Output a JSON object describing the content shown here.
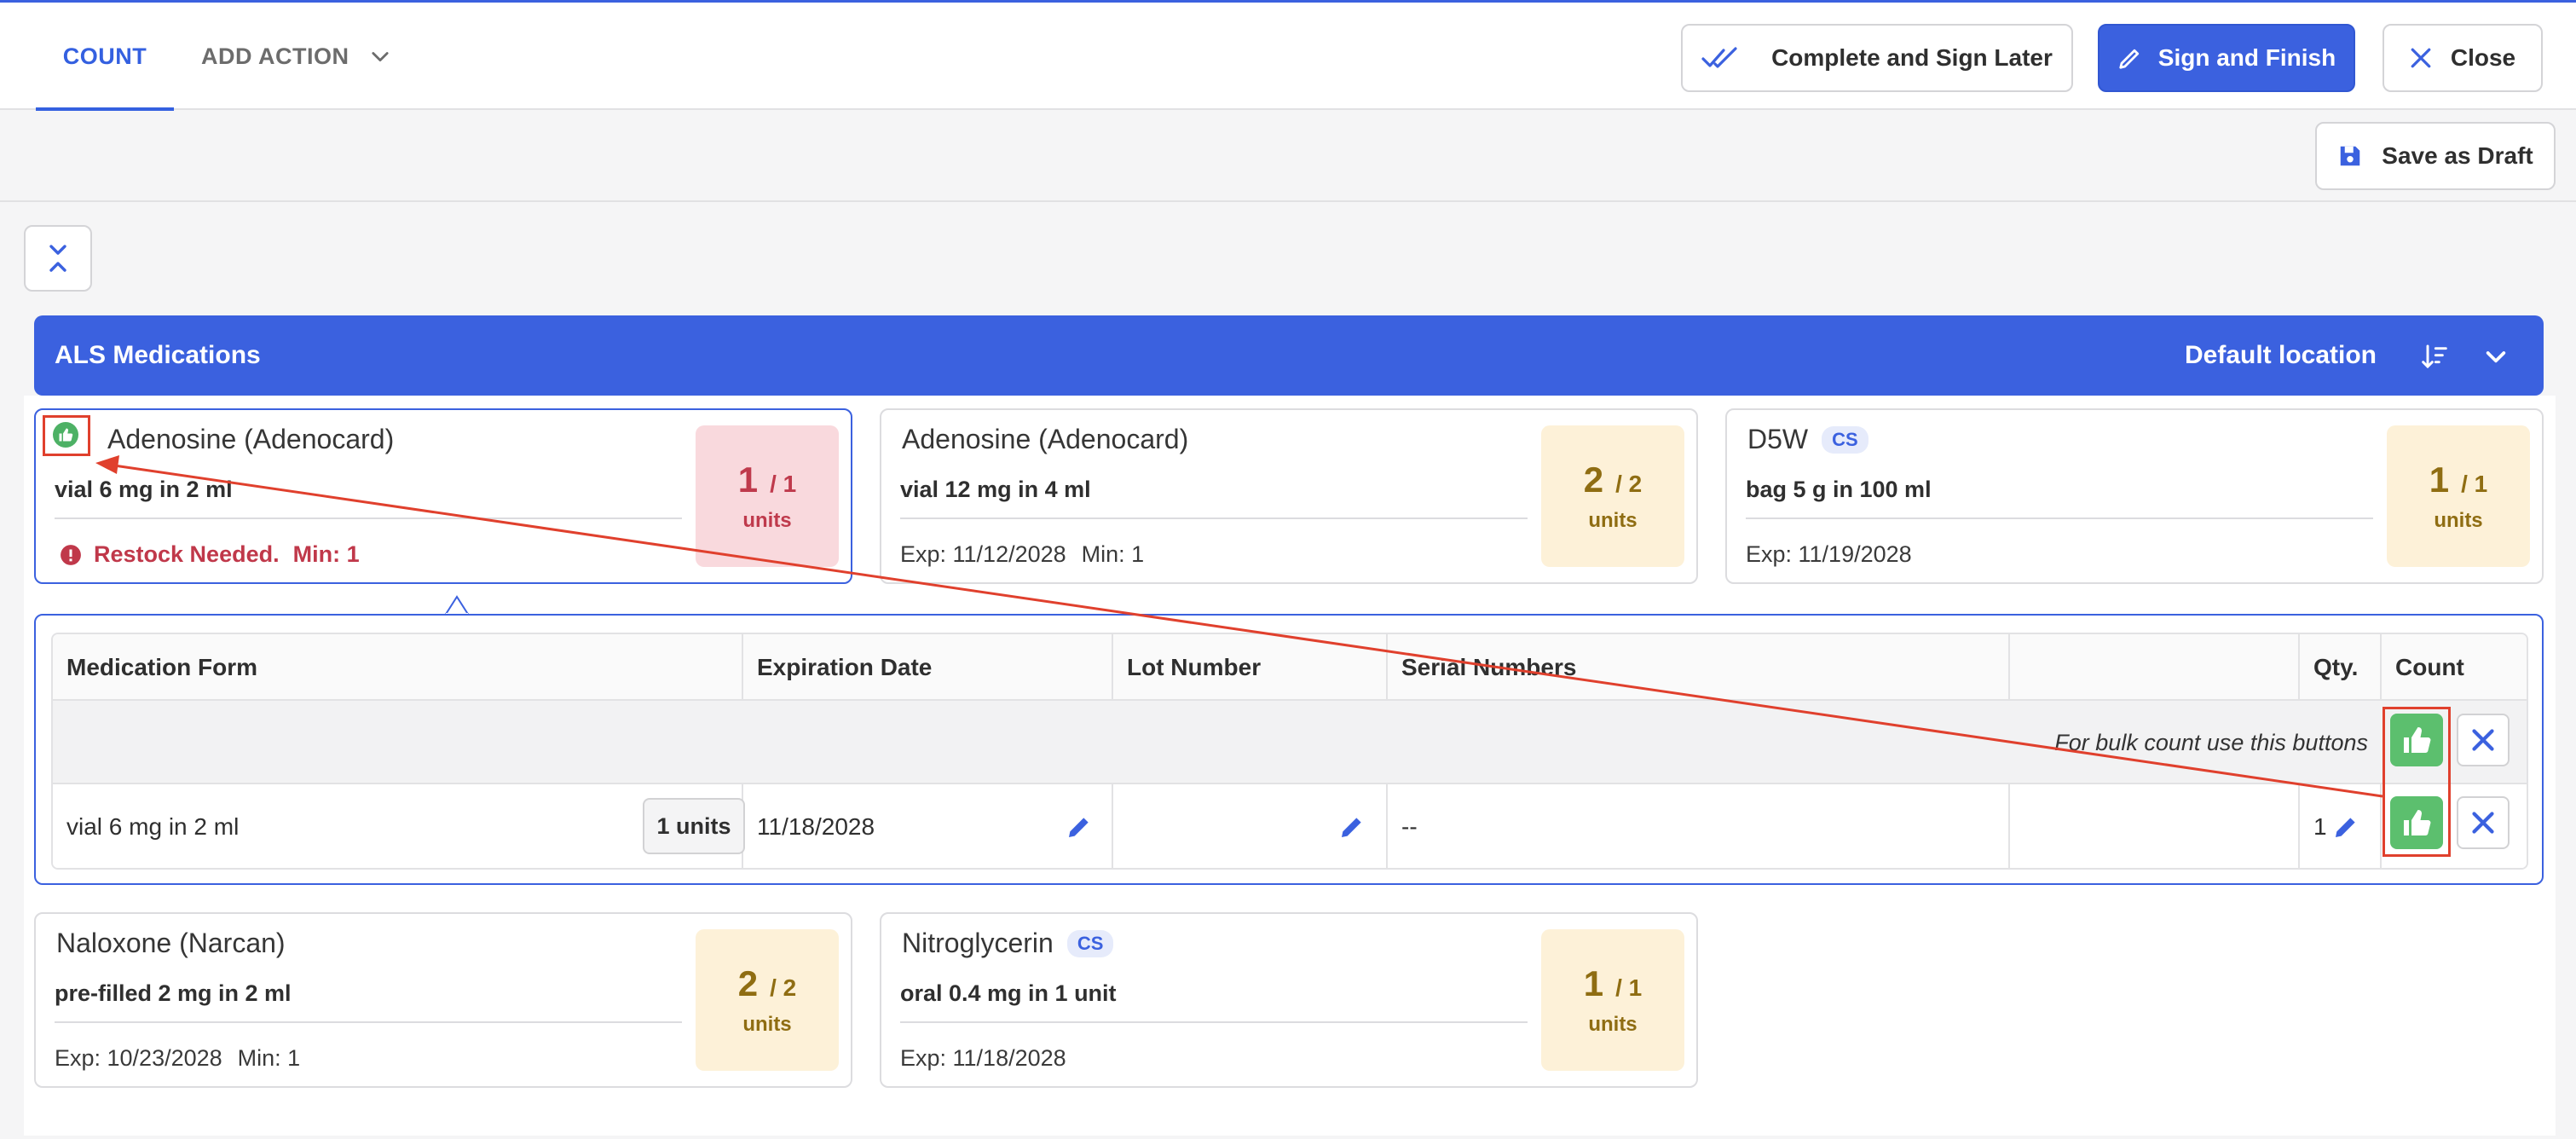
{
  "tabs": {
    "count": "COUNT",
    "add_action": "ADD ACTION"
  },
  "buttons": {
    "complete_later": "Complete and Sign Later",
    "sign_finish": "Sign and Finish",
    "close": "Close",
    "save_draft": "Save as Draft"
  },
  "section": {
    "title": "ALS Medications",
    "location": "Default location"
  },
  "cards": [
    {
      "name": "Adenosine (Adenocard)",
      "form": "vial 6 mg in 2 ml",
      "restock": "Restock Needed.",
      "min": "Min: 1",
      "qty": "1",
      "of": "/ 1",
      "unit": "units"
    },
    {
      "name": "Adenosine (Adenocard)",
      "form": "vial 12 mg in 4 ml",
      "exp": "Exp: 11/12/2028",
      "min": "Min: 1",
      "qty": "2",
      "of": "/ 2",
      "unit": "units"
    },
    {
      "name": "D5W",
      "badge": "CS",
      "form": "bag 5 g in 100 ml",
      "exp": "Exp: 11/19/2028",
      "qty": "1",
      "of": "/ 1",
      "unit": "units"
    },
    {
      "name": "Naloxone (Narcan)",
      "form": "pre-filled 2 mg in 2 ml",
      "exp": "Exp: 10/23/2028",
      "min": "Min: 1",
      "qty": "2",
      "of": "/ 2",
      "unit": "units"
    },
    {
      "name": "Nitroglycerin",
      "badge": "CS",
      "form": "oral 0.4 mg in 1 unit",
      "exp": "Exp: 11/18/2028",
      "qty": "1",
      "of": "/ 1",
      "unit": "units"
    }
  ],
  "table": {
    "headers": [
      "Medication Form",
      "Expiration Date",
      "Lot Number",
      "Serial Numbers",
      "",
      "Qty.",
      "Count"
    ],
    "bulk_hint": "For bulk count use this buttons",
    "row": {
      "form": "vial 6 mg in 2 ml",
      "units": "1 units",
      "expiration": "11/18/2028",
      "serial": "--",
      "qty": "1"
    }
  },
  "colors": {
    "accent": "#3b61df",
    "success": "#5cbf6e",
    "danger": "#c0384a",
    "annotation": "#e0402d"
  },
  "icons": [
    "double-check-icon",
    "pencil-icon",
    "close-icon",
    "save-icon",
    "collapse-icon",
    "sort-icon",
    "chevron-down-icon",
    "thumbs-up-icon",
    "info-icon"
  ]
}
